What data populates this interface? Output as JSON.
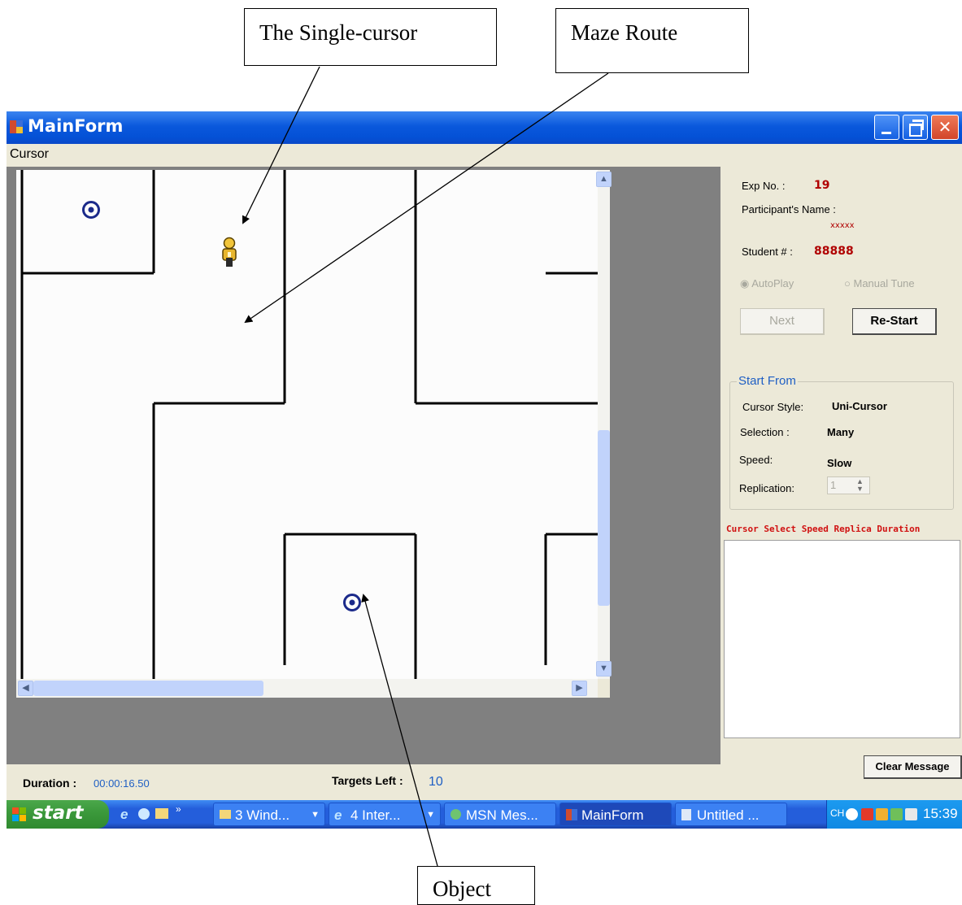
{
  "callouts": {
    "single_cursor": "The Single-cursor",
    "maze_route": "Maze Route",
    "object": "Object"
  },
  "window": {
    "title": "MainForm",
    "menu": [
      "Cursor"
    ]
  },
  "panel": {
    "exp_no_label": "Exp No. :",
    "exp_no_value": "19",
    "participant_label": "Participant's Name :",
    "participant_value": "xxxxx",
    "student_label": "Student # :",
    "student_value": "88888",
    "autoplay_label": "AutoPlay",
    "autoplay_selected": true,
    "manual_tune_label": "Manual Tune",
    "next_label": "Next",
    "restart_label": "Re-Start",
    "start_from": {
      "legend": "Start From",
      "cursor_style_label": "Cursor Style:",
      "cursor_style_value": "Uni-Cursor",
      "selection_label": "Selection :",
      "selection_value": "Many",
      "speed_label": "Speed:",
      "speed_value": "Slow",
      "replication_label": "Replication:",
      "replication_value": "1"
    },
    "message_header": "Cursor Select Speed Replica Duration",
    "clear_message_label": "Clear Message"
  },
  "status": {
    "duration_label": "Duration :",
    "duration_value": "00:00:16.50",
    "targets_left_label": "Targets Left :",
    "targets_left_value": "10"
  },
  "taskbar": {
    "start_label": "start",
    "tasks": [
      "3 Wind...",
      "4 Inter...",
      "MSN Mes...",
      "MainForm",
      "Untitled ..."
    ],
    "active_task": "MainForm",
    "tray_lang": "CH",
    "clock": "15:39"
  },
  "colors": {
    "title_blue": "#0a58dc",
    "close_red": "#e04a2a",
    "value_red": "#b00000",
    "duration_blue": "#1f5fc4",
    "target_navy": "#1b2a8a",
    "taskbar_blue": "#245edb",
    "start_green": "#3c9a3c"
  }
}
